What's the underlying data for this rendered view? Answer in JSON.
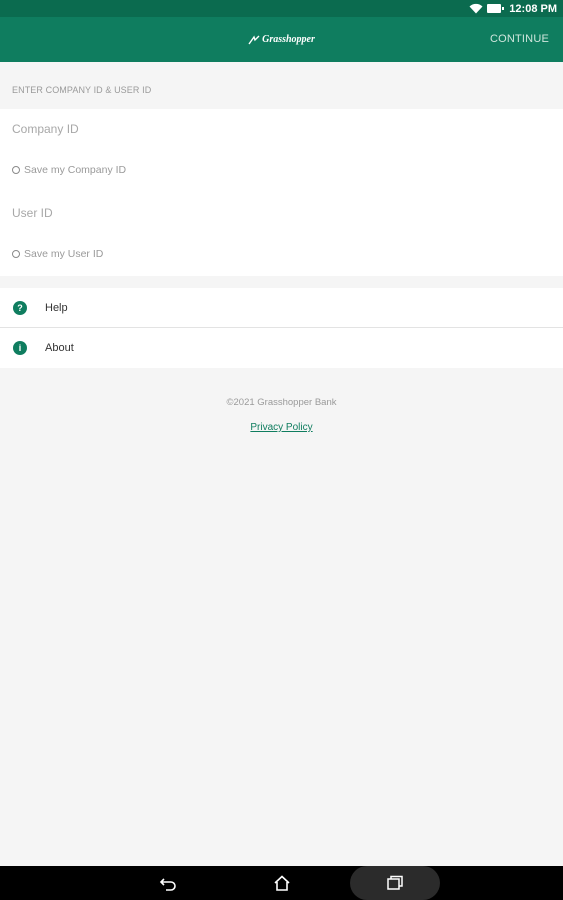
{
  "status_bar": {
    "time": "12:08 PM",
    "icons": [
      "wifi-icon",
      "battery-icon"
    ]
  },
  "app_bar": {
    "logo_text": "Grasshopper",
    "continue_label": "CONTINUE"
  },
  "login": {
    "section_header": "ENTER COMPANY ID & USER ID",
    "company_id_placeholder": "Company ID",
    "save_company_label": "Save my Company ID",
    "user_id_placeholder": "User ID",
    "save_user_label": "Save my User ID"
  },
  "menu": {
    "help_label": "Help",
    "help_icon_glyph": "?",
    "about_label": "About",
    "about_icon_glyph": "i"
  },
  "footer": {
    "copyright": "©2021 Grasshopper Bank",
    "privacy_link": "Privacy Policy"
  },
  "colors": {
    "status_bar": "#0b6b4f",
    "app_bar": "#0f7d5f",
    "accent": "#0f7d5f",
    "background": "#f5f5f5"
  }
}
